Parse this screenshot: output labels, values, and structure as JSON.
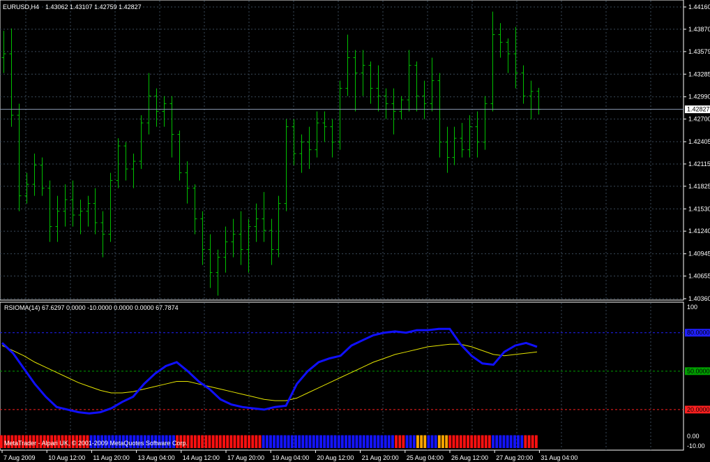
{
  "main_chart": {
    "symbol_label": "EURUSD,H4",
    "ohlc_label": "1.43062 1.43107 1.42759 1.42827",
    "current_price_label": "1.42827",
    "current_price": 1.42827,
    "price_axis_labels": [
      "1.44160",
      "1.43870",
      "1.43579",
      "1.43285",
      "1.42990",
      "1.42700",
      "1.42405",
      "1.42115",
      "1.41825",
      "1.41530",
      "1.41240",
      "1.40945",
      "1.40655",
      "1.40360"
    ],
    "up_bar_color": "#00c000",
    "grid_color": "#3a4a5a"
  },
  "indicator": {
    "label": "RSIOMA(14) 67.6297 0.0000 -10.0000 0.0000 0.0000 67.7874",
    "axis_labels": {
      "top": "100",
      "level_80": "80.0000",
      "level_50": "50.0000",
      "level_20": "20.0000",
      "zero": "0.00",
      "neg": "-10.00"
    },
    "level_colors": {
      "80": "#2020ff",
      "50": "#00a000",
      "20": "#ff2020"
    },
    "rsi_color": "#1010ff",
    "ma_color": "#e6e600",
    "histogram_colors": {
      "down": "#ff1010",
      "up": "#1414ff",
      "neutral": "#ffa500",
      "green": "#00c000"
    }
  },
  "copyright": "MetaTrader - Alpari UK, © 2001-2009 MetaQuotes Software Corp.",
  "time_axis_labels": [
    "7 Aug 2009",
    "10 Aug 12:00",
    "11 Aug 20:00",
    "13 Aug 04:00",
    "14 Aug 12:00",
    "17 Aug 20:00",
    "19 Aug 04:00",
    "20 Aug 12:00",
    "21 Aug 20:00",
    "25 Aug 04:00",
    "26 Aug 12:00",
    "27 Aug 20:00",
    "31 Aug 04:00"
  ],
  "chart_data": [
    {
      "type": "ohlc",
      "title": "EURUSD,H4",
      "ylim": [
        1.4036,
        1.4416
      ],
      "series": [
        {
          "name": "EURUSD",
          "ohlc": [
            [
              1.435,
              1.4385,
              1.433,
              1.4355
            ],
            [
              1.4355,
              1.4388,
              1.426,
              1.4275
            ],
            [
              1.4275,
              1.429,
              1.415,
              1.417
            ],
            [
              1.417,
              1.42,
              1.416,
              1.4185
            ],
            [
              1.4185,
              1.4225,
              1.417,
              1.421
            ],
            [
              1.421,
              1.422,
              1.417,
              1.418
            ],
            [
              1.418,
              1.419,
              1.411,
              1.413
            ],
            [
              1.413,
              1.417,
              1.411,
              1.415
            ],
            [
              1.415,
              1.4185,
              1.413,
              1.4165
            ],
            [
              1.4165,
              1.419,
              1.413,
              1.4145
            ],
            [
              1.4145,
              1.4165,
              1.412,
              1.415
            ],
            [
              1.415,
              1.417,
              1.413,
              1.416
            ],
            [
              1.416,
              1.418,
              1.412,
              1.4135
            ],
            [
              1.4135,
              1.415,
              1.409,
              1.412
            ],
            [
              1.412,
              1.42,
              1.411,
              1.419
            ],
            [
              1.419,
              1.4245,
              1.418,
              1.4235
            ],
            [
              1.4235,
              1.424,
              1.419,
              1.4205
            ],
            [
              1.4205,
              1.4225,
              1.418,
              1.4215
            ],
            [
              1.4215,
              1.4275,
              1.4205,
              1.4265
            ],
            [
              1.4265,
              1.433,
              1.425,
              1.43
            ],
            [
              1.43,
              1.431,
              1.426,
              1.428
            ],
            [
              1.428,
              1.43,
              1.426,
              1.429
            ],
            [
              1.429,
              1.43,
              1.422,
              1.425
            ],
            [
              1.425,
              1.4255,
              1.419,
              1.42
            ],
            [
              1.42,
              1.4215,
              1.416,
              1.418
            ],
            [
              1.418,
              1.4185,
              1.412,
              1.414
            ],
            [
              1.414,
              1.415,
              1.408,
              1.41
            ],
            [
              1.41,
              1.412,
              1.405,
              1.407
            ],
            [
              1.407,
              1.41,
              1.404,
              1.409
            ],
            [
              1.409,
              1.413,
              1.407,
              1.411
            ],
            [
              1.411,
              1.414,
              1.409,
              1.412
            ],
            [
              1.412,
              1.415,
              1.408,
              1.41
            ],
            [
              1.41,
              1.414,
              1.407,
              1.413
            ],
            [
              1.413,
              1.416,
              1.411,
              1.414
            ],
            [
              1.414,
              1.4175,
              1.411,
              1.4125
            ],
            [
              1.4125,
              1.414,
              1.408,
              1.41
            ],
            [
              1.41,
              1.417,
              1.409,
              1.416
            ],
            [
              1.416,
              1.427,
              1.415,
              1.426
            ],
            [
              1.426,
              1.427,
              1.421,
              1.4225
            ],
            [
              1.4225,
              1.425,
              1.42,
              1.424
            ],
            [
              1.424,
              1.426,
              1.4205,
              1.423
            ],
            [
              1.423,
              1.428,
              1.422,
              1.4265
            ],
            [
              1.4265,
              1.428,
              1.424,
              1.426
            ],
            [
              1.426,
              1.427,
              1.422,
              1.424
            ],
            [
              1.424,
              1.432,
              1.423,
              1.431
            ],
            [
              1.431,
              1.438,
              1.43,
              1.435
            ],
            [
              1.435,
              1.436,
              1.428,
              1.433
            ],
            [
              1.433,
              1.436,
              1.43,
              1.434
            ],
            [
              1.434,
              1.4345,
              1.429,
              1.431
            ],
            [
              1.431,
              1.434,
              1.428,
              1.43
            ],
            [
              1.43,
              1.431,
              1.427,
              1.429
            ],
            [
              1.429,
              1.431,
              1.425,
              1.428
            ],
            [
              1.428,
              1.43,
              1.427,
              1.4295
            ],
            [
              1.4295,
              1.436,
              1.428,
              1.434
            ],
            [
              1.434,
              1.4345,
              1.428,
              1.43
            ],
            [
              1.43,
              1.432,
              1.427,
              1.429
            ],
            [
              1.429,
              1.435,
              1.428,
              1.432
            ],
            [
              1.432,
              1.433,
              1.422,
              1.424
            ],
            [
              1.424,
              1.426,
              1.42,
              1.422
            ],
            [
              1.422,
              1.426,
              1.421,
              1.4245
            ],
            [
              1.4245,
              1.4265,
              1.422,
              1.423
            ],
            [
              1.423,
              1.4275,
              1.422,
              1.426
            ],
            [
              1.426,
              1.428,
              1.422,
              1.424
            ],
            [
              1.424,
              1.43,
              1.423,
              1.429
            ],
            [
              1.429,
              1.441,
              1.428,
              1.438
            ],
            [
              1.438,
              1.4395,
              1.435,
              1.437
            ],
            [
              1.437,
              1.4375,
              1.433,
              1.4355
            ],
            [
              1.4355,
              1.439,
              1.431,
              1.433
            ],
            [
              1.433,
              1.434,
              1.429,
              1.43
            ],
            [
              1.43,
              1.432,
              1.427,
              1.4306
            ],
            [
              1.43062,
              1.43107,
              1.42759,
              1.42827
            ]
          ]
        }
      ]
    },
    {
      "type": "line",
      "title": "RSIOMA(14)",
      "ylim": [
        -10,
        100
      ],
      "series": [
        {
          "values": [
            72,
            64,
            52,
            40,
            30,
            22,
            20,
            18,
            17,
            18,
            21,
            26,
            30,
            40,
            48,
            54,
            57,
            50,
            42,
            36,
            28,
            24,
            22,
            21,
            20,
            22,
            23,
            40,
            50,
            57,
            60,
            62,
            70,
            74,
            78,
            80,
            81,
            80,
            82,
            82,
            83,
            83,
            71,
            62,
            56,
            55,
            65,
            70,
            72,
            69
          ]
        },
        {
          "values": [
            70,
            66,
            62,
            57,
            53,
            49,
            45,
            41,
            38,
            35,
            33,
            33,
            34,
            36,
            38,
            40,
            42,
            42,
            40,
            38,
            36,
            34,
            32,
            30,
            28,
            27,
            27,
            29,
            33,
            37,
            41,
            45,
            49,
            53,
            57,
            60,
            63,
            65,
            67,
            69,
            70,
            71,
            71,
            69,
            66,
            63,
            62,
            63,
            64,
            65
          ]
        }
      ]
    }
  ]
}
